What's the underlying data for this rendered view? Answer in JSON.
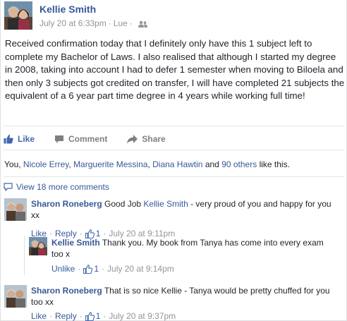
{
  "post": {
    "author": "Kellie Smith",
    "timestamp": "July 20 at 6:33pm",
    "location": "Lue",
    "privacy_icon": "friends-icon",
    "text": "Received confirmation today that I definitely only have this 1 subject left to complete my Bachelor of Laws. I also realised that although I started my degree in 2008, taking into account I had to defer 1 semester when moving to Biloela and then only 3 subjects got credited on transfer, I will have completed 21 subjects the equivalent of a 6 year part time degree in 4 years while working full time!"
  },
  "actions": {
    "like": "Like",
    "comment": "Comment",
    "share": "Share"
  },
  "likes": {
    "prefix": "You, ",
    "names": [
      "Nicole Errey",
      "Marguerite Messina",
      "Diana Hawtin"
    ],
    "sep1": ", ",
    "sep2": ", ",
    "and": " and ",
    "others": "90 others",
    "suffix": " like this."
  },
  "view_more": "View 18 more comments",
  "comments": [
    {
      "author": "Sharon Roneberg",
      "text_before": "Good Job ",
      "mention": "Kellie Smith",
      "text_after": " - very proud of you and happy for you",
      "text_line2": "xx",
      "like_label": "Like",
      "reply_label": "Reply",
      "like_count": "1",
      "time": "July 20 at 9:11pm"
    },
    {
      "author": "Kellie Smith",
      "text": "Thank you. My book from Tanya has come into every exam",
      "text_line2": "too x",
      "like_label": "Unlike",
      "like_count": "1",
      "time": "July 20 at 9:14pm"
    },
    {
      "author": "Sharon Roneberg",
      "text": "That is so nice Kellie - Tanya would be pretty chuffed for you",
      "text_line2": "too xx",
      "like_label": "Like",
      "reply_label": "Reply",
      "like_count": "1",
      "time": "July 20 at 9:37pm"
    }
  ],
  "separators": {
    "dot": "·"
  },
  "colors": {
    "link": "#365899",
    "meta": "#90949c",
    "like_blue": "#4267b2"
  }
}
